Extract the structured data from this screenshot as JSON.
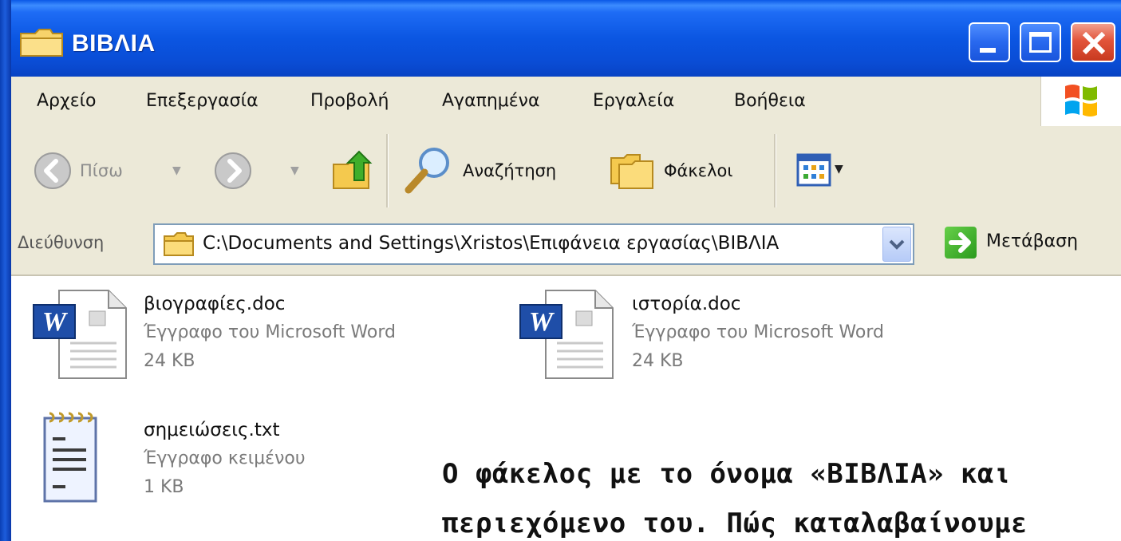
{
  "window": {
    "title": "ΒΙΒΛΙΑ"
  },
  "menu": [
    {
      "label": "Αρχείο"
    },
    {
      "label": "Επεξεργασία"
    },
    {
      "label": "Προβολή"
    },
    {
      "label": "Αγαπημένα"
    },
    {
      "label": "Εργαλεία"
    },
    {
      "label": "Βοήθεια"
    }
  ],
  "toolbar": {
    "back_label": "Πίσω",
    "search_label": "Αναζήτηση",
    "folders_label": "Φάκελοι"
  },
  "address": {
    "label": "Διεύθυνση",
    "path": "C:\\Documents and Settings\\Xristos\\Επιφάνεια εργασίας\\ΒΙΒΛΙΑ",
    "go_label": "Μετάβαση"
  },
  "files": [
    {
      "name": "βιογραφίες.doc",
      "type": "Έγγραφο του Microsoft Word",
      "size": "24 KB",
      "icon": "word-document-icon"
    },
    {
      "name": "ιστορία.doc",
      "type": "Έγγραφο του Microsoft Word",
      "size": "24 KB",
      "icon": "word-document-icon"
    },
    {
      "name": "σημειώσεις.txt",
      "type": "Έγγραφο κειμένου",
      "size": "1 KB",
      "icon": "text-document-icon"
    }
  ],
  "caption": {
    "line1": "Ο φάκελος με το όνομα «ΒΙΒΛΙΑ» και",
    "line2": "περιεχόμενο του. Πώς καταλαβαίνουμε"
  },
  "colors": {
    "titlebar": "#0a4dd6",
    "chrome": "#ece9d8",
    "close_button": "#e2543a"
  }
}
